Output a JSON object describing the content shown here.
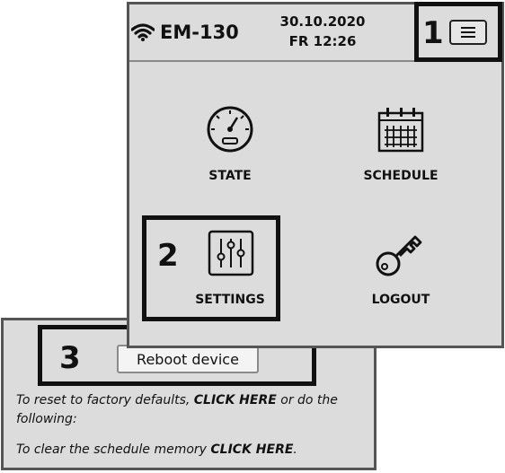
{
  "header": {
    "device_name": "EM-130",
    "date": "30.10.2020",
    "time": "FR 12:26",
    "icons": {
      "wifi": "wifi-icon",
      "menu": "hamburger-menu-icon"
    }
  },
  "menu": {
    "items": [
      {
        "label": "STATE",
        "icon": "gauge-icon"
      },
      {
        "label": "SCHEDULE",
        "icon": "calendar-icon"
      },
      {
        "label": "SETTINGS",
        "icon": "sliders-icon"
      },
      {
        "label": "LOGOUT",
        "icon": "key-icon"
      }
    ]
  },
  "callouts": [
    "1",
    "2",
    "3"
  ],
  "settings_page": {
    "reboot_label": "Reboot device",
    "reset_prefix": "To reset to factory defaults, ",
    "reset_link": "CLICK HERE",
    "reset_suffix": " or do the",
    "reset_line2": "following:",
    "clear_prefix": "To clear the schedule memory ",
    "clear_link": "CLICK HERE",
    "clear_suffix": "."
  },
  "colors": {
    "panel_bg": "#dcdcdc",
    "panel_border": "#555555",
    "callout_border": "#111111"
  }
}
